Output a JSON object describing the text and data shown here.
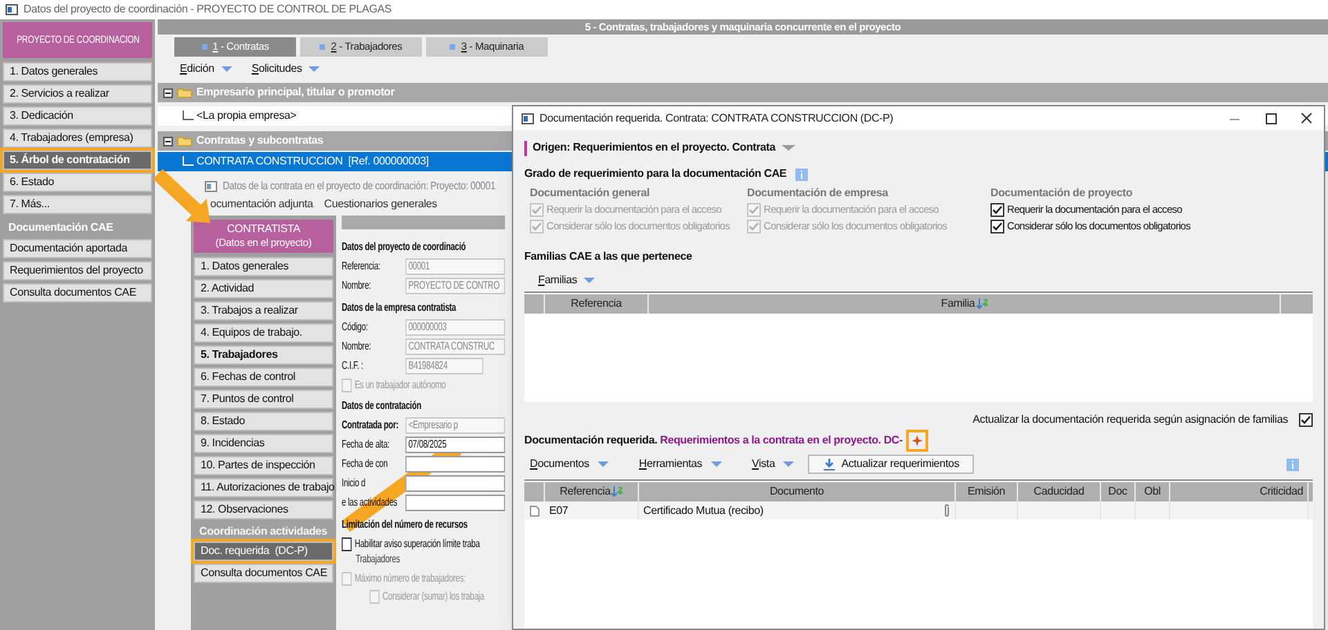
{
  "window": {
    "title": "Datos del proyecto de coordinación - PROYECTO DE CONTROL DE PLAGAS"
  },
  "sidebar": {
    "header": "PROYECTO DE COORDINACION",
    "items": [
      {
        "kind": "item",
        "label": "1. Datos generales",
        "selected": false,
        "highlighted": false
      },
      {
        "kind": "item",
        "label": "2. Servicios a realizar",
        "selected": false,
        "highlighted": false
      },
      {
        "kind": "item",
        "label": "3. Dedicación",
        "selected": false,
        "highlighted": false
      },
      {
        "kind": "item",
        "label": "4. Trabajadores (empresa)",
        "selected": false,
        "highlighted": false
      },
      {
        "kind": "item",
        "label": "5. Árbol de contratación",
        "selected": true,
        "highlighted": true
      },
      {
        "kind": "item",
        "label": "6. Estado",
        "selected": false,
        "highlighted": false
      },
      {
        "kind": "item",
        "label": "7. Más...",
        "selected": false,
        "highlighted": false
      },
      {
        "kind": "section",
        "label": "Documentación CAE"
      },
      {
        "kind": "item",
        "label": "Documentación aportada",
        "selected": false,
        "highlighted": false
      },
      {
        "kind": "item",
        "label": "Requerimientos del proyecto",
        "selected": false,
        "highlighted": false
      },
      {
        "kind": "item",
        "label": "Consulta documentos CAE",
        "selected": false,
        "highlighted": false
      }
    ]
  },
  "main": {
    "header": "5 - Contratas, trabajadores y maquinaria concurrente en el proyecto",
    "tabs": [
      {
        "label": "1 - Contratas",
        "selected": true
      },
      {
        "label": "2 - Trabajadores",
        "selected": false
      },
      {
        "label": "3 - Maquinaria",
        "selected": false
      }
    ],
    "menus": [
      "Edición",
      "Solicitudes"
    ],
    "tree": [
      {
        "label": "Empresario principal, titular o promotor",
        "expanded": true,
        "children": [
          {
            "label": "<La propia empresa>",
            "selected": false
          }
        ]
      },
      {
        "label": "Contratas y subcontratas",
        "expanded": true,
        "children": [
          {
            "label": "CONTRATA CONSTRUCCION  [Ref. 000000003]",
            "selected": true
          }
        ]
      }
    ]
  },
  "detail": {
    "title": "Datos de la contrata en el proyecto de coordinación: Proyecto: 00001",
    "tabs": [
      "ocumentación adjunta",
      "Cuestionarios generales"
    ],
    "sidebar": {
      "header": "CONTRATISTA",
      "subheader": "(Datos en el proyecto)",
      "items": [
        {
          "kind": "item",
          "label": "1. Datos generales",
          "selected": false,
          "bold": false,
          "highlighted": false
        },
        {
          "kind": "item",
          "label": "2. Actividad",
          "selected": false,
          "bold": false,
          "highlighted": false
        },
        {
          "kind": "item",
          "label": "3. Trabajos a realizar",
          "selected": false,
          "bold": false,
          "highlighted": false
        },
        {
          "kind": "item",
          "label": "4. Equipos de trabajo.",
          "selected": false,
          "bold": false,
          "highlighted": false
        },
        {
          "kind": "item",
          "label": "5. Trabajadores",
          "selected": false,
          "bold": true,
          "highlighted": false
        },
        {
          "kind": "item",
          "label": "6. Fechas de control",
          "selected": false,
          "bold": false,
          "highlighted": false
        },
        {
          "kind": "item",
          "label": "7. Puntos de control",
          "selected": false,
          "bold": false,
          "highlighted": false
        },
        {
          "kind": "item",
          "label": "8. Estado",
          "selected": false,
          "bold": false,
          "highlighted": false
        },
        {
          "kind": "item",
          "label": "9. Incidencias",
          "selected": false,
          "bold": false,
          "highlighted": false
        },
        {
          "kind": "item",
          "label": "10. Partes de inspección",
          "selected": false,
          "bold": false,
          "highlighted": false
        },
        {
          "kind": "item",
          "label": "11. Autorizaciones de trabajo",
          "selected": false,
          "bold": false,
          "highlighted": false
        },
        {
          "kind": "item",
          "label": "12. Observaciones",
          "selected": false,
          "bold": false,
          "highlighted": false
        },
        {
          "kind": "section",
          "label": "Coordinación actividades"
        },
        {
          "kind": "item",
          "label": "Doc. requerida  (DC-P)",
          "selected": true,
          "bold": false,
          "highlighted": true
        },
        {
          "kind": "item",
          "label": "Consulta documentos CAE",
          "selected": false,
          "bold": false,
          "highlighted": false
        }
      ]
    },
    "form": [
      {
        "kind": "heading",
        "text": "Datos del proyecto de coordinació"
      },
      {
        "kind": "field",
        "label": "Referencia:",
        "value": "00001",
        "disabled": true
      },
      {
        "kind": "field",
        "label": "Nombre:",
        "value": "PROYECTO DE CONTRO",
        "disabled": true
      },
      {
        "kind": "heading",
        "text": "Datos de la empresa contratista"
      },
      {
        "kind": "field",
        "label": "Código:",
        "value": "000000003",
        "disabled": true
      },
      {
        "kind": "field",
        "label": "Nombre:",
        "value": "CONTRATA CONSTRUC",
        "disabled": true
      },
      {
        "kind": "short_field",
        "label": "C.I.F. :",
        "value": "B41984824",
        "disabled": true
      },
      {
        "kind": "checkbox",
        "label": "Es un trabajador autónomo",
        "checked": false,
        "disabled": true
      },
      {
        "kind": "heading",
        "text": "Datos de contratación"
      },
      {
        "kind": "field",
        "label": "Contratada por:",
        "value": "<Empresario p",
        "disabled": true,
        "bold": true
      },
      {
        "kind": "field",
        "label": "Fecha de alta:",
        "value": "07/08/2025",
        "disabled": false
      },
      {
        "kind": "field",
        "label": "Fecha de con",
        "disabled": false
      },
      {
        "kind": "field",
        "label": "Inicio d",
        "disabled": false
      },
      {
        "kind": "field",
        "label": "e las actividades",
        "disabled": false
      },
      {
        "kind": "heading",
        "text": "Limitación del número de recursos"
      },
      {
        "kind": "checkbox",
        "label": "Habilitar aviso superación límite traba",
        "checked": false,
        "disabled": false
      },
      {
        "kind": "subheading",
        "text": "Trabajadores"
      },
      {
        "kind": "checkbox",
        "label": "Máximo número de trabajadores:",
        "checked": false,
        "disabled": true
      },
      {
        "kind": "subcheckbox",
        "label": "Considerar (sumar) los trabaja",
        "checked": false,
        "disabled": true
      }
    ]
  },
  "dialog": {
    "title": "Documentación requerida. Contrata: CONTRATA CONSTRUCCION (DC-P)",
    "origin": "Origen: Requerimientos en el proyecto. Contrata",
    "requirement_title": "Grado de requerimiento para la documentación CAE",
    "groups": [
      {
        "title": "Documentación general",
        "disabled": true,
        "options": [
          {
            "label": "Requerir la documentación para el acceso",
            "checked": true
          },
          {
            "label": "Considerar sólo los documentos obligatorios",
            "checked": true
          }
        ]
      },
      {
        "title": "Documentación de empresa",
        "disabled": true,
        "options": [
          {
            "label": "Requerir la documentación para el acceso",
            "checked": true
          },
          {
            "label": "Considerar sólo los documentos obligatorios",
            "checked": true
          }
        ]
      },
      {
        "title": "Documentación de proyecto",
        "disabled": false,
        "options": [
          {
            "label": "Requerir la documentación para el acceso",
            "checked": true
          },
          {
            "label": "Considerar sólo los documentos obligatorios",
            "checked": true
          }
        ]
      }
    ],
    "families": {
      "title": "Familias CAE a las que pertenece",
      "menu": "Familias",
      "columns": [
        {
          "label": "Referencia",
          "sortable": false
        },
        {
          "label": "Familia",
          "sortable": true
        }
      ]
    },
    "update_by_families": {
      "label": "Actualizar la documentación requerida según asignación de familias",
      "checked": true
    },
    "required_docs": {
      "title": "Documentación requerida.",
      "subtitle": "Requerimientos a la contrata en el proyecto. DC-",
      "menus": [
        "Documentos",
        "Herramientas",
        "Vista"
      ],
      "button": "Actualizar requerimientos",
      "columns": [
        {
          "label": "Referencia",
          "sortable": true
        },
        {
          "label": "Documento",
          "sortable": false
        },
        {
          "label": "Emisión",
          "sortable": false
        },
        {
          "label": "Caducidad",
          "sortable": false
        },
        {
          "label": "Doc",
          "sortable": false
        },
        {
          "label": "Obl",
          "sortable": false
        },
        {
          "label": "Criticidad",
          "sortable": false
        }
      ],
      "rows": [
        {
          "reference": "E07",
          "document": "Certificado Mutua (recibo)",
          "attachment": true
        }
      ]
    }
  }
}
